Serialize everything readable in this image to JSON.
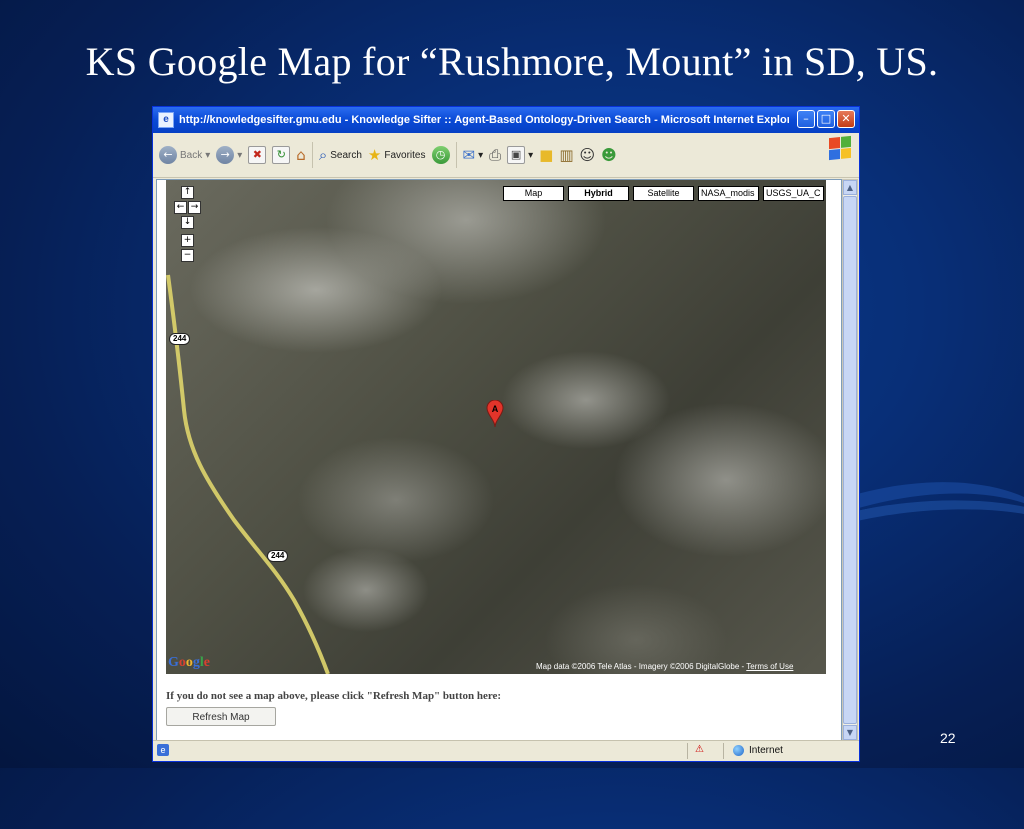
{
  "slide": {
    "title": "KS Google Map for “Rushmore, Mount” in SD, US.",
    "number": "22"
  },
  "browser": {
    "window_title": "http://knowledgesifter.gmu.edu - Knowledge Sifter :: Agent-Based Ontology-Driven Search - Microsoft Internet Explorer",
    "toolbar": {
      "back_label": "Back",
      "search_label": "Search",
      "favorites_label": "Favorites"
    },
    "status_zone": "Internet"
  },
  "map": {
    "types": [
      "Map",
      "Hybrid",
      "Satellite",
      "NASA_modis",
      "USGS_UA_C"
    ],
    "active_type": "Hybrid",
    "route_shields": [
      "244",
      "244"
    ],
    "marker_label": "A",
    "logo": "Google",
    "attribution": "Map data ©2006 Tele Atlas - Imagery ©2006 DigitalGlobe - ",
    "terms_link": "Terms of Use"
  },
  "page": {
    "refresh_note": "If you do not see a map above, please click \"Refresh Map\" button here:",
    "refresh_button": "Refresh Map"
  },
  "colors": {
    "slide_bg": "#082f78",
    "titlebar": "#0a4ad6",
    "road": "#d8cf6a",
    "marker": "#e2342a"
  },
  "icons": [
    "back-icon",
    "forward-icon",
    "stop-icon",
    "refresh-icon",
    "home-icon",
    "search-icon",
    "favorites-icon",
    "history-icon",
    "mail-icon",
    "print-icon",
    "edit-icon",
    "folder-icon",
    "research-icon",
    "messenger-icon",
    "windows-flag-icon",
    "ie-page-icon",
    "security-icon",
    "internet-zone-icon"
  ]
}
